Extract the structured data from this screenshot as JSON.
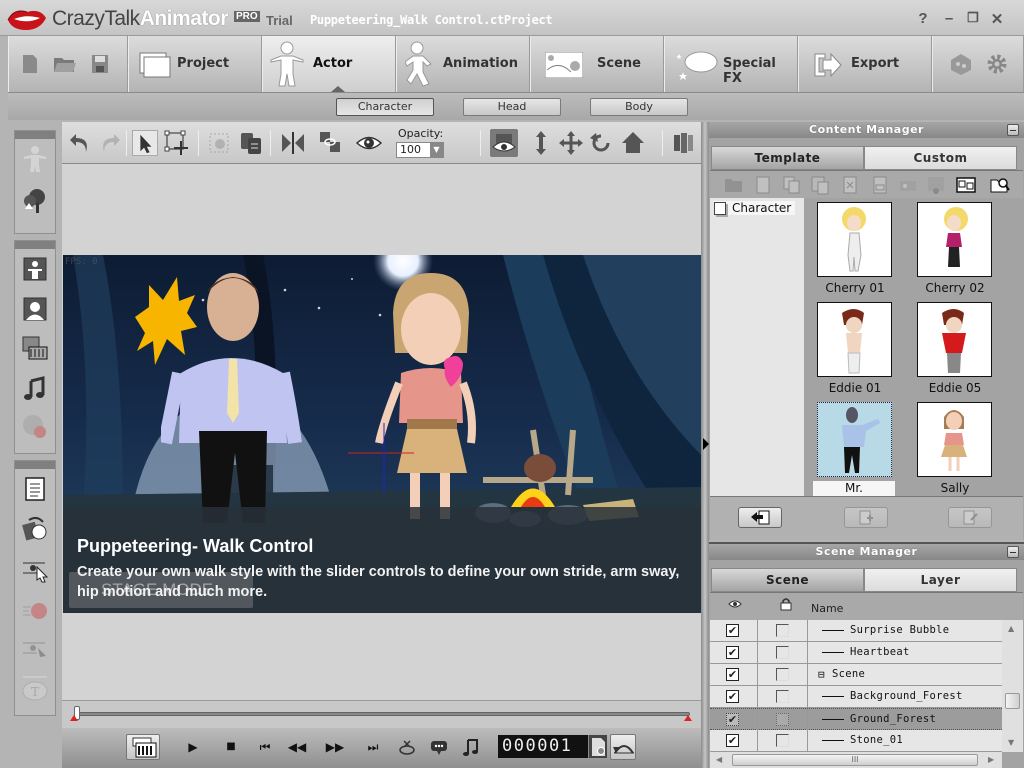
{
  "titlebar": {
    "app_name_light": "CrazyTalk",
    "app_name_bold": "Animator",
    "edition_badge": "PRO",
    "license": "Trial",
    "project_file": "Puppeteering_Walk Control.ctProject",
    "help": "?",
    "minimize": "–",
    "restore": "❐",
    "close": "✕"
  },
  "main_tabs": [
    {
      "label": "Project",
      "icon": "folder-window-icon",
      "active": false
    },
    {
      "label": "Actor",
      "icon": "actor-figure-icon",
      "active": true
    },
    {
      "label": "Animation",
      "icon": "running-figure-icon",
      "active": false
    },
    {
      "label": "Scene",
      "icon": "scene-landscape-icon",
      "active": false
    },
    {
      "label": "Special FX",
      "icon": "speech-bubble-stars-icon",
      "active": false
    },
    {
      "label": "Export",
      "icon": "export-arrow-icon",
      "active": false
    }
  ],
  "file_buttons": [
    "new-file-icon",
    "open-folder-icon",
    "save-disk-icon"
  ],
  "sub_tabs": [
    {
      "label": "Character",
      "active": true
    },
    {
      "label": "Head",
      "active": false
    },
    {
      "label": "Body",
      "active": false
    }
  ],
  "stage_toolbar": {
    "opacity_label": "Opacity:",
    "opacity_value": "100",
    "tools": [
      "undo",
      "redo",
      "select",
      "transform",
      "group",
      "clone",
      "flip",
      "link",
      "visibility",
      "camera-view",
      "move-vertical",
      "move",
      "rotate",
      "home",
      "sequence"
    ]
  },
  "left_toolbox": {
    "groups": [
      {
        "tools": [
          "actor-figure",
          "tree-props"
        ]
      },
      {
        "tools": [
          "body-puppet",
          "face-puppet",
          "motion-clip",
          "audio-note",
          "speech-record"
        ]
      },
      {
        "tools": [
          "script",
          "rotate-sprite",
          "motion-key",
          "record-motion",
          "path-key",
          "text-bubble"
        ]
      }
    ]
  },
  "stage": {
    "fps_text": "FPS: 0",
    "caption_title": "Puppeteering- Walk Control",
    "caption_body": "Create your own walk style with the slider controls to define your own stride, arm sway, hip motion and much more.",
    "overlay_mode": "STAGE MODE"
  },
  "timeline": {
    "progress": 0,
    "frame_counter": "000001"
  },
  "playback": [
    "play",
    "stop",
    "first-frame",
    "rewind",
    "fast-forward",
    "last-frame",
    "record-face",
    "speech",
    "audio"
  ],
  "content_manager": {
    "title": "Content Manager",
    "tabs": [
      {
        "label": "Template",
        "active": true
      },
      {
        "label": "Custom",
        "active": false
      }
    ],
    "tree": [
      {
        "label": "Character"
      }
    ],
    "items": [
      {
        "label": "Cherry 01",
        "selected": false
      },
      {
        "label": "Cherry 02",
        "selected": false
      },
      {
        "label": "Eddie 01",
        "selected": false
      },
      {
        "label": "Eddie 05",
        "selected": false
      },
      {
        "label": "Mr. Rosenberg",
        "selected": true
      },
      {
        "label": "Sally",
        "selected": false
      }
    ]
  },
  "scene_manager": {
    "title": "Scene Manager",
    "tabs": [
      {
        "label": "Scene",
        "active": true
      },
      {
        "label": "Layer",
        "active": false
      }
    ],
    "column_name": "Name",
    "rows": [
      {
        "name": "Surprise Bubble",
        "visible": true,
        "locked": false,
        "indent": 2,
        "selected": false
      },
      {
        "name": "Heartbeat",
        "visible": true,
        "locked": false,
        "indent": 2,
        "selected": false
      },
      {
        "name": "Scene",
        "visible": true,
        "locked": false,
        "indent": 1,
        "selected": false,
        "expander": "⊟"
      },
      {
        "name": "Background_Forest",
        "visible": true,
        "locked": false,
        "indent": 2,
        "selected": false
      },
      {
        "name": "Ground_Forest",
        "visible": true,
        "locked": false,
        "indent": 2,
        "selected": true
      },
      {
        "name": "Stone_01",
        "visible": true,
        "locked": false,
        "indent": 2,
        "selected": false
      }
    ],
    "hscroll_grip": "III"
  },
  "colors": {
    "stage_sky": "#0d1c33",
    "sun_yellow": "#f7b500",
    "heart_pink": "#f0409a",
    "timeline_marker": "#d22222"
  }
}
